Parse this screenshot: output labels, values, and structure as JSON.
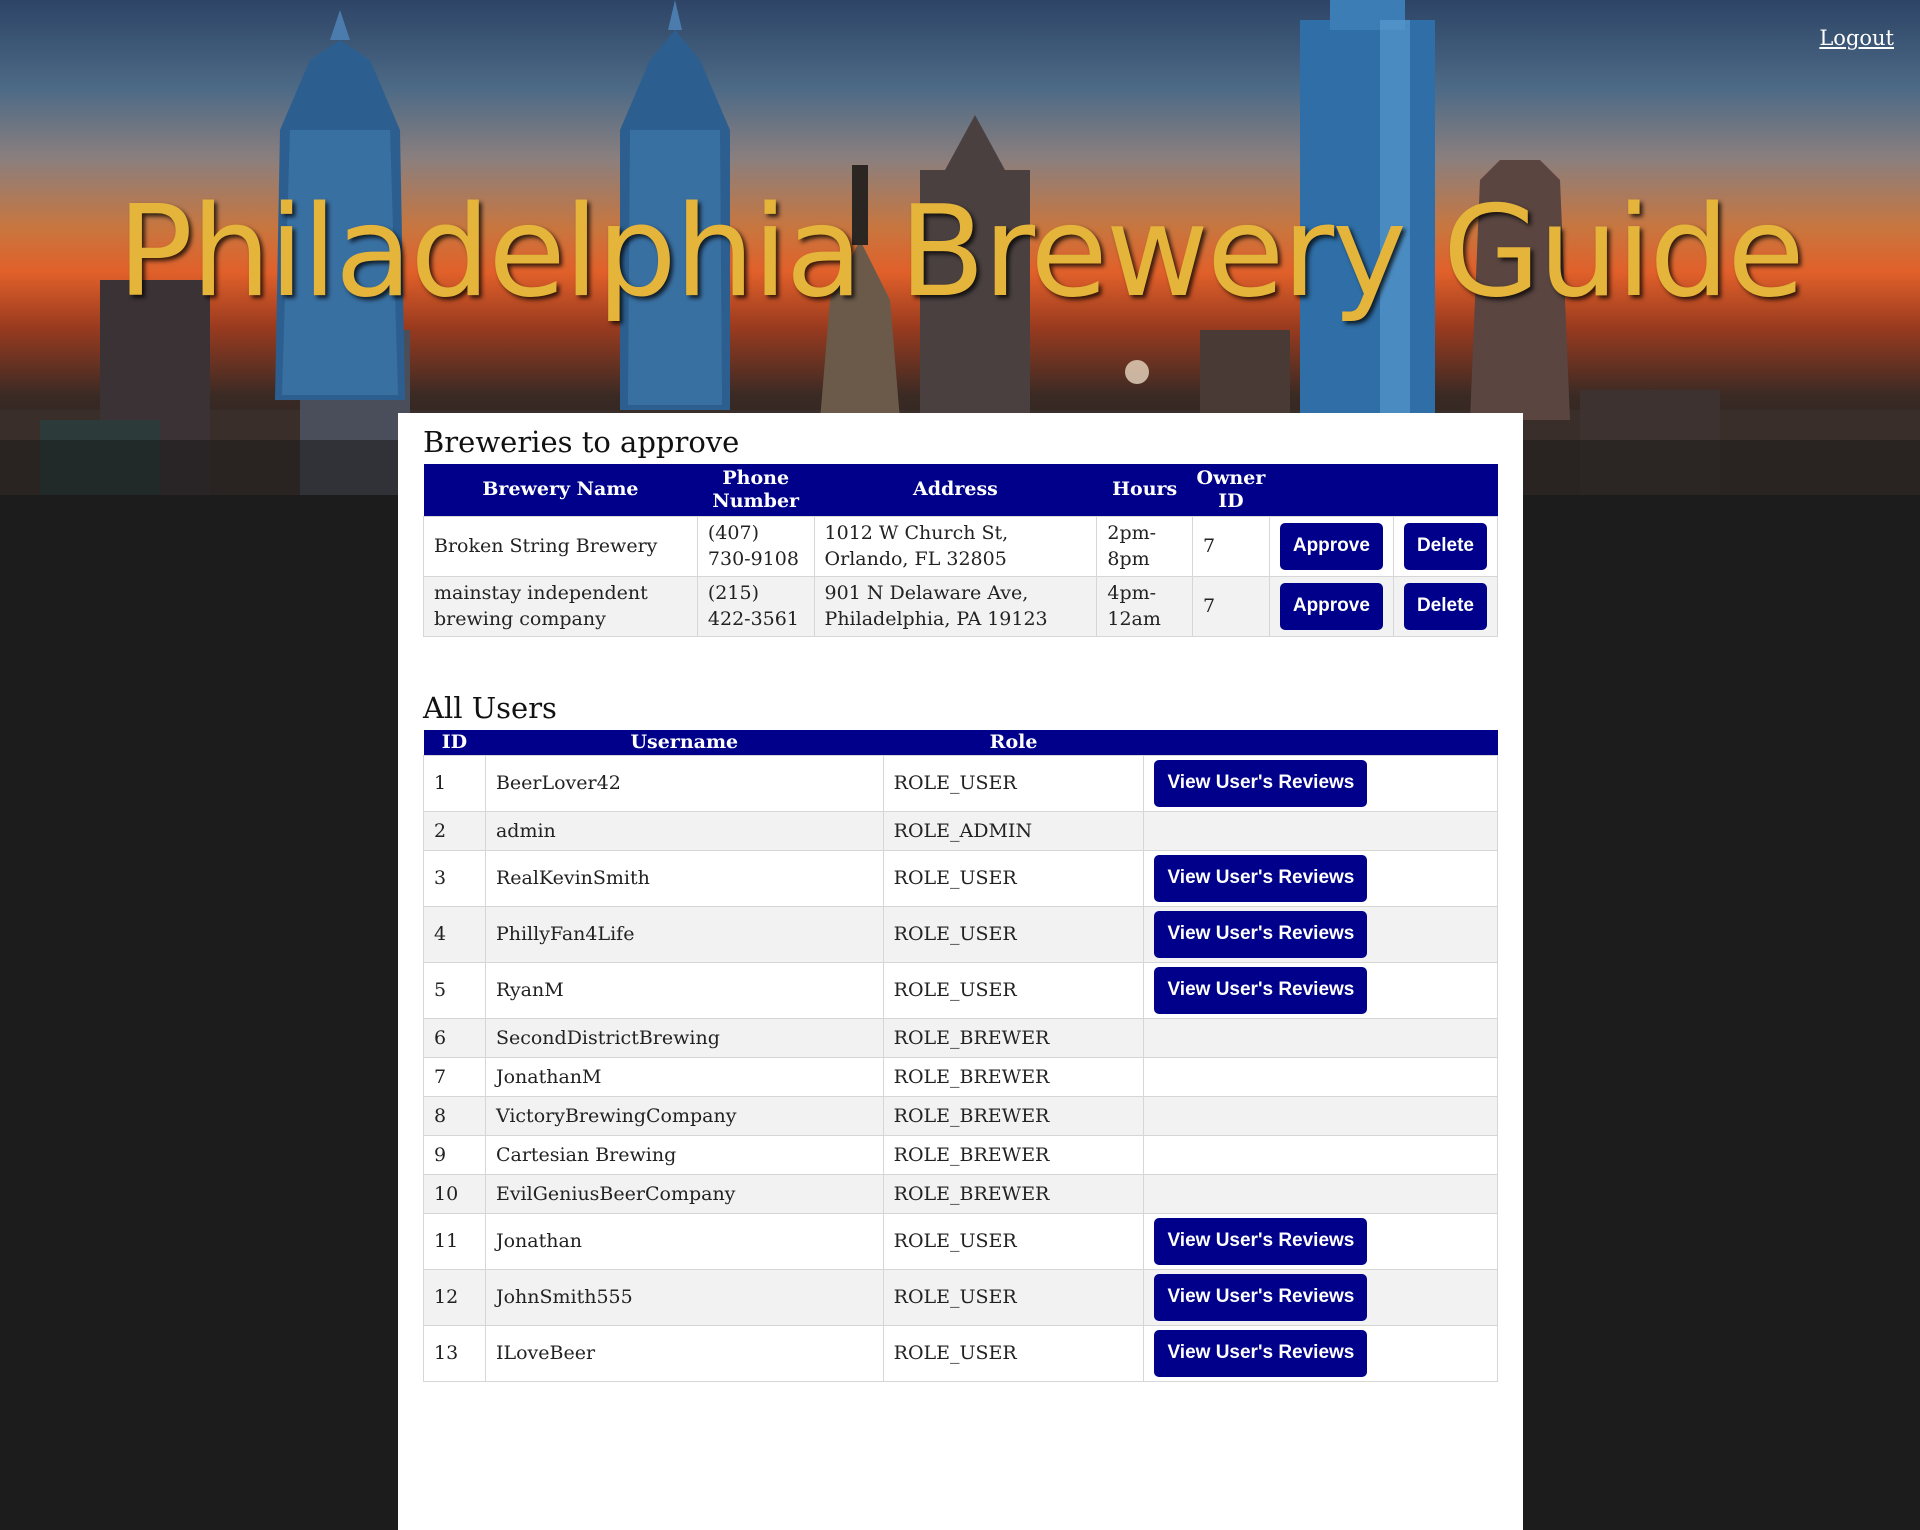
{
  "header": {
    "title": "Philadelphia Brewery Guide",
    "logout_label": "Logout"
  },
  "breweries": {
    "heading": "Breweries to approve",
    "columns": [
      "Brewery Name",
      "Phone Number",
      "Address",
      "Hours",
      "Owner ID"
    ],
    "approve_label": "Approve",
    "delete_label": "Delete",
    "rows": [
      {
        "name": "Broken String Brewery",
        "phone": "(407) 730-9108",
        "address": "1012 W Church St, Orlando, FL 32805",
        "hours": "2pm-8pm",
        "owner_id": "7"
      },
      {
        "name": "mainstay independent brewing company",
        "phone": "(215) 422-3561",
        "address": "901 N Delaware Ave, Philadelphia, PA 19123",
        "hours": "4pm-12am",
        "owner_id": "7"
      }
    ]
  },
  "users": {
    "heading": "All Users",
    "columns": [
      "ID",
      "Username",
      "Role"
    ],
    "view_reviews_label": "View User's Reviews",
    "rows": [
      {
        "id": "1",
        "username": "BeerLover42",
        "role": "ROLE_USER",
        "has_button": true
      },
      {
        "id": "2",
        "username": "admin",
        "role": "ROLE_ADMIN",
        "has_button": false
      },
      {
        "id": "3",
        "username": "RealKevinSmith",
        "role": "ROLE_USER",
        "has_button": true
      },
      {
        "id": "4",
        "username": "PhillyFan4Life",
        "role": "ROLE_USER",
        "has_button": true
      },
      {
        "id": "5",
        "username": "RyanM",
        "role": "ROLE_USER",
        "has_button": true
      },
      {
        "id": "6",
        "username": "SecondDistrictBrewing",
        "role": "ROLE_BREWER",
        "has_button": false
      },
      {
        "id": "7",
        "username": "JonathanM",
        "role": "ROLE_BREWER",
        "has_button": false
      },
      {
        "id": "8",
        "username": "VictoryBrewingCompany",
        "role": "ROLE_BREWER",
        "has_button": false
      },
      {
        "id": "9",
        "username": "Cartesian Brewing",
        "role": "ROLE_BREWER",
        "has_button": false
      },
      {
        "id": "10",
        "username": "EvilGeniusBeerCompany",
        "role": "ROLE_BREWER",
        "has_button": false
      },
      {
        "id": "11",
        "username": "Jonathan",
        "role": "ROLE_USER",
        "has_button": true
      },
      {
        "id": "12",
        "username": "JohnSmith555",
        "role": "ROLE_USER",
        "has_button": true
      },
      {
        "id": "13",
        "username": "ILoveBeer",
        "role": "ROLE_USER",
        "has_button": true
      }
    ]
  },
  "colors": {
    "accent": "#00008b",
    "title": "#e5b43a",
    "page_background": "#1c1c1c"
  }
}
